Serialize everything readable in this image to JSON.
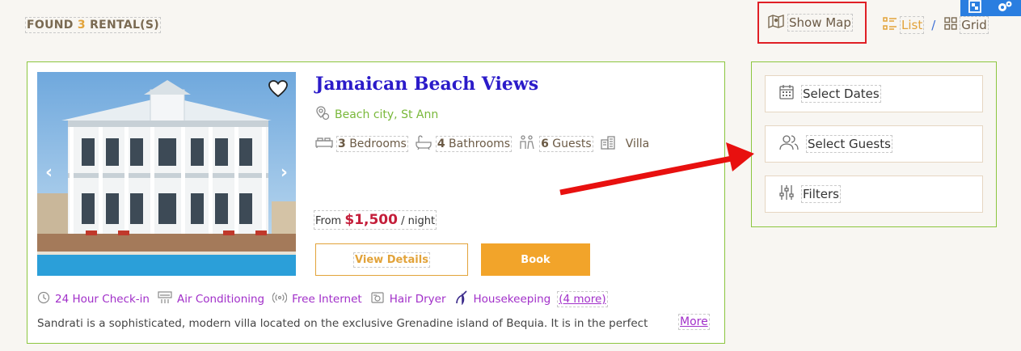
{
  "header": {
    "found_prefix": "FOUND",
    "found_count": "3",
    "found_suffix": "RENTAL(S)",
    "show_map": "Show Map",
    "view_list": "List",
    "view_sep": "/",
    "view_grid": "Grid"
  },
  "listing": {
    "title": "Jamaican Beach Views",
    "location": "Beach city, St Ann",
    "bedrooms_count": "3",
    "bedrooms_label": "Bedrooms",
    "bathrooms_count": "4",
    "bathrooms_label": "Bathrooms",
    "guests_count": "6",
    "guests_label": "Guests",
    "type": "Villa",
    "price_from": "From",
    "price": "$1,500",
    "price_unit": "/ night",
    "view_details": "View Details",
    "book": "Book",
    "features": [
      "24 Hour Check-in",
      "Air Conditioning",
      "Free Internet",
      "Hair Dryer",
      "Housekeeping"
    ],
    "features_more": "(4 more)",
    "description": "Sandrati is a sophisticated, modern villa located on the exclusive Grenadine island of Bequia. It is in the perfect",
    "description_more": "More"
  },
  "sidebar": {
    "select_dates": "Select Dates",
    "select_guests": "Select Guests",
    "filters": "Filters"
  },
  "colors": {
    "accent_orange": "#f2a42a",
    "title_blue": "#2b1bc9",
    "feature_purple": "#a12fc9",
    "price_red": "#c41e3a",
    "border_green": "#8cc63f",
    "highlight_red": "#e01f26"
  }
}
